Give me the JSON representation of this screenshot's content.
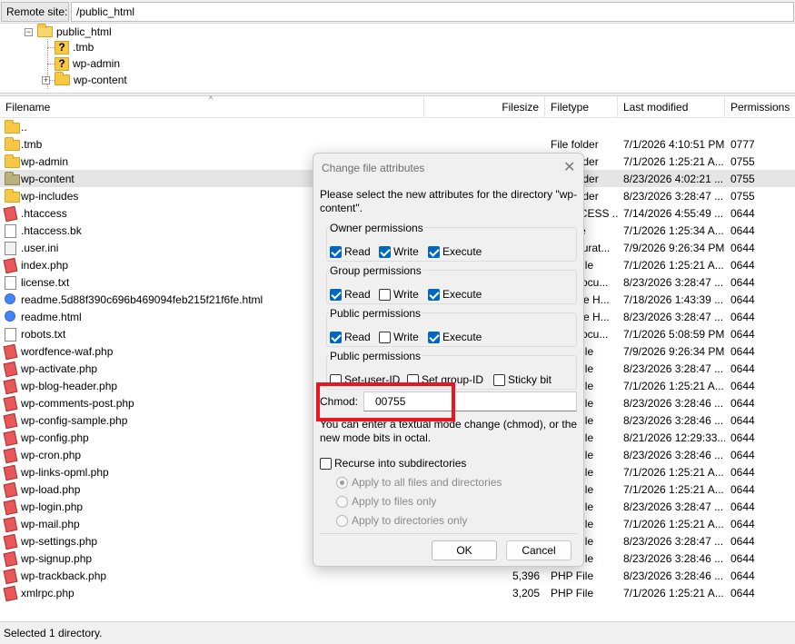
{
  "remote_site": {
    "label": "Remote site:",
    "path": "/public_html"
  },
  "tree": {
    "items": [
      {
        "label": "public_html",
        "icon": "folder-open-icon"
      },
      {
        "label": ".tmb",
        "icon": "unknown-folder-icon"
      },
      {
        "label": "wp-admin",
        "icon": "unknown-folder-icon"
      },
      {
        "label": "wp-content",
        "icon": "folder-icon"
      }
    ]
  },
  "columns": {
    "filename": "Filename",
    "filesize": "Filesize",
    "filetype": "Filetype",
    "modified": "Last modified",
    "permissions": "Permissions"
  },
  "files": [
    {
      "name": "..",
      "size": "",
      "type": "",
      "modified": "",
      "perm": "",
      "icon": "folder"
    },
    {
      "name": ".tmb",
      "size": "",
      "type": "File folder",
      "modified": "7/1/2026 4:10:51 PM",
      "perm": "0777",
      "icon": "folder"
    },
    {
      "name": "wp-admin",
      "size": "",
      "type": "File folder",
      "modified": "7/1/2026 1:25:21 A...",
      "perm": "0755",
      "icon": "folder"
    },
    {
      "name": "wp-content",
      "size": "",
      "type": "File folder",
      "modified": "8/23/2026 4:02:21 ...",
      "perm": "0755",
      "icon": "folder-gray",
      "selected": true
    },
    {
      "name": "wp-includes",
      "size": "",
      "type": "File folder",
      "modified": "8/23/2026 3:28:47 ...",
      "perm": "0755",
      "icon": "folder"
    },
    {
      "name": ".htaccess",
      "size": "",
      "type": "HTACCESS ...",
      "modified": "7/14/2026 4:55:49 ...",
      "perm": "0644",
      "icon": "php"
    },
    {
      "name": ".htaccess.bk",
      "size": "",
      "type": "BK File",
      "modified": "7/1/2026 1:25:34 A...",
      "perm": "0644",
      "icon": "file"
    },
    {
      "name": ".user.ini",
      "size": "",
      "type": "Configurat...",
      "modified": "7/9/2026 9:26:34 PM",
      "perm": "0644",
      "icon": "ini"
    },
    {
      "name": "index.php",
      "size": "",
      "type": "PHP File",
      "modified": "7/1/2026 1:25:21 A...",
      "perm": "0644",
      "icon": "php"
    },
    {
      "name": "license.txt",
      "size": "",
      "type": "Text Docu...",
      "modified": "8/23/2026 3:28:47 ...",
      "perm": "0644",
      "icon": "file"
    },
    {
      "name": "readme.5d88f390c696b469094feb215f21f6fe.html",
      "size": "",
      "type": "Chrome H...",
      "modified": "7/18/2026 1:43:39 ...",
      "perm": "0644",
      "icon": "html"
    },
    {
      "name": "readme.html",
      "size": "",
      "type": "Chrome H...",
      "modified": "8/23/2026 3:28:47 ...",
      "perm": "0644",
      "icon": "html"
    },
    {
      "name": "robots.txt",
      "size": "",
      "type": "Text Docu...",
      "modified": "7/1/2026 5:08:59 PM",
      "perm": "0644",
      "icon": "file"
    },
    {
      "name": "wordfence-waf.php",
      "size": "",
      "type": "PHP File",
      "modified": "7/9/2026 9:26:34 PM",
      "perm": "0644",
      "icon": "php"
    },
    {
      "name": "wp-activate.php",
      "size": "",
      "type": "PHP File",
      "modified": "8/23/2026 3:28:47 ...",
      "perm": "0644",
      "icon": "php"
    },
    {
      "name": "wp-blog-header.php",
      "size": "",
      "type": "PHP File",
      "modified": "7/1/2026 1:25:21 A...",
      "perm": "0644",
      "icon": "php"
    },
    {
      "name": "wp-comments-post.php",
      "size": "",
      "type": "PHP File",
      "modified": "8/23/2026 3:28:46 ...",
      "perm": "0644",
      "icon": "php"
    },
    {
      "name": "wp-config-sample.php",
      "size": "",
      "type": "PHP File",
      "modified": "8/23/2026 3:28:46 ...",
      "perm": "0644",
      "icon": "php"
    },
    {
      "name": "wp-config.php",
      "size": "",
      "type": "PHP File",
      "modified": "8/21/2026 12:29:33...",
      "perm": "0644",
      "icon": "php"
    },
    {
      "name": "wp-cron.php",
      "size": "",
      "type": "PHP File",
      "modified": "8/23/2026 3:28:46 ...",
      "perm": "0644",
      "icon": "php"
    },
    {
      "name": "wp-links-opml.php",
      "size": "",
      "type": "PHP File",
      "modified": "7/1/2026 1:25:21 A...",
      "perm": "0644",
      "icon": "php"
    },
    {
      "name": "wp-load.php",
      "size": "",
      "type": "PHP File",
      "modified": "7/1/2026 1:25:21 A...",
      "perm": "0644",
      "icon": "php"
    },
    {
      "name": "wp-login.php",
      "size": "",
      "type": "PHP File",
      "modified": "8/23/2026 3:28:47 ...",
      "perm": "0644",
      "icon": "php"
    },
    {
      "name": "wp-mail.php",
      "size": "",
      "type": "PHP File",
      "modified": "7/1/2026 1:25:21 A...",
      "perm": "0644",
      "icon": "php"
    },
    {
      "name": "wp-settings.php",
      "size": "",
      "type": "PHP File",
      "modified": "8/23/2026 3:28:47 ...",
      "perm": "0644",
      "icon": "php"
    },
    {
      "name": "wp-signup.php",
      "size": "",
      "type": "PHP File",
      "modified": "8/23/2026 3:28:46 ...",
      "perm": "0644",
      "icon": "php"
    },
    {
      "name": "wp-trackback.php",
      "size": "5,396",
      "type": "PHP File",
      "modified": "8/23/2026 3:28:46 ...",
      "perm": "0644",
      "icon": "php"
    },
    {
      "name": "xmlrpc.php",
      "size": "3,205",
      "type": "PHP File",
      "modified": "7/1/2026 1:25:21 A...",
      "perm": "0644",
      "icon": "php"
    }
  ],
  "status": "Selected 1 directory.",
  "dialog": {
    "title": "Change file attributes",
    "description": "Please select the new attributes for the directory \"wp-content\".",
    "groups": [
      {
        "label": "Owner permissions",
        "options": [
          {
            "label": "Read",
            "checked": true
          },
          {
            "label": "Write",
            "checked": true
          },
          {
            "label": "Execute",
            "checked": true
          }
        ]
      },
      {
        "label": "Group permissions",
        "options": [
          {
            "label": "Read",
            "checked": true
          },
          {
            "label": "Write",
            "checked": false
          },
          {
            "label": "Execute",
            "checked": true
          }
        ]
      },
      {
        "label": "Public permissions",
        "options": [
          {
            "label": "Read",
            "checked": true
          },
          {
            "label": "Write",
            "checked": false
          },
          {
            "label": "Execute",
            "checked": true
          }
        ]
      },
      {
        "label": "Public permissions",
        "options": [
          {
            "label": "Set-user-ID",
            "checked": false
          },
          {
            "label": "Set group-ID",
            "checked": false
          },
          {
            "label": "Sticky bit",
            "checked": false
          }
        ]
      }
    ],
    "chmod_label": "Chmod:",
    "chmod_value": "00755",
    "hint": "You can enter a textual mode change (chmod), or the new mode bits in octal.",
    "recurse_label": "Recurse into subdirectories",
    "recurse_options": [
      {
        "label": "Apply to all files and directories",
        "selected": true
      },
      {
        "label": "Apply to files only",
        "selected": false
      },
      {
        "label": "Apply to directories only",
        "selected": false
      }
    ],
    "ok_label": "OK",
    "cancel_label": "Cancel"
  }
}
